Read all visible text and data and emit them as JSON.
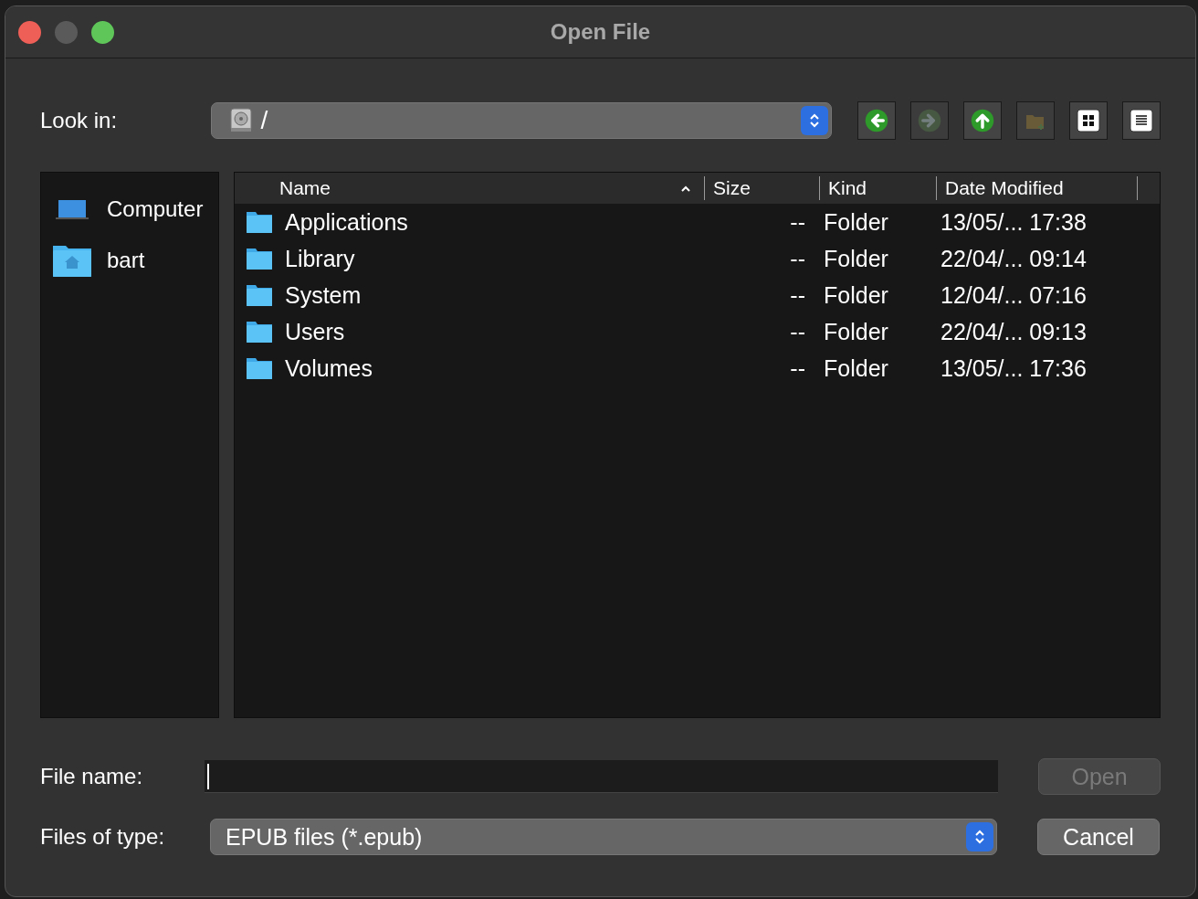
{
  "window": {
    "title": "Open File"
  },
  "look_in": {
    "label": "Look in:",
    "value": "/"
  },
  "toolbar": [
    {
      "kind": "back",
      "disabled": false
    },
    {
      "kind": "forward",
      "disabled": true
    },
    {
      "kind": "up",
      "disabled": false
    },
    {
      "kind": "new-folder",
      "disabled": true
    },
    {
      "kind": "icon-view"
    },
    {
      "kind": "list-view"
    }
  ],
  "sidebar": {
    "items": [
      {
        "kind": "computer",
        "label": "Computer"
      },
      {
        "kind": "home",
        "label": "bart"
      }
    ]
  },
  "table": {
    "columns": [
      {
        "label": "Name",
        "sorted": true
      },
      {
        "label": "Size",
        "sorted": false
      },
      {
        "label": "Kind",
        "sorted": false
      },
      {
        "label": "Date Modified",
        "sorted": false
      }
    ],
    "rows": [
      {
        "name": "Applications",
        "size": "--",
        "kind": "Folder",
        "date": "13/05/... 17:38"
      },
      {
        "name": "Library",
        "size": "--",
        "kind": "Folder",
        "date": "22/04/... 09:14"
      },
      {
        "name": "System",
        "size": "--",
        "kind": "Folder",
        "date": "12/04/... 07:16"
      },
      {
        "name": "Users",
        "size": "--",
        "kind": "Folder",
        "date": "22/04/... 09:13"
      },
      {
        "name": "Volumes",
        "size": "--",
        "kind": "Folder",
        "date": "13/05/... 17:36"
      }
    ]
  },
  "file_name": {
    "label": "File name:",
    "focused": true
  },
  "file_type": {
    "label": "Files of type:",
    "value": "EPUB files (*.epub)"
  },
  "buttons": [
    {
      "label": "Open",
      "disabled": true
    },
    {
      "label": "Cancel",
      "disabled": false
    }
  ]
}
